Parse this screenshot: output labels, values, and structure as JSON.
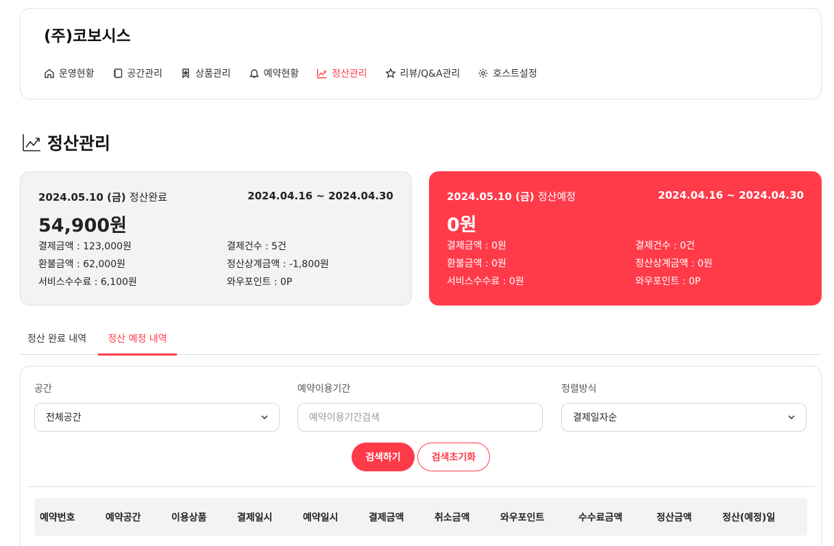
{
  "company": "(주)코보시스",
  "nav": [
    {
      "label": "운영현황",
      "icon": "home-icon"
    },
    {
      "label": "공간관리",
      "icon": "notebook-icon"
    },
    {
      "label": "상품관리",
      "icon": "bookmark-icon"
    },
    {
      "label": "예약현황",
      "icon": "bell-icon"
    },
    {
      "label": "정산관리",
      "icon": "trend-up-icon",
      "active": true
    },
    {
      "label": "리뷰/Q&A관리",
      "icon": "star-icon"
    },
    {
      "label": "호스트설정",
      "icon": "gear-icon"
    }
  ],
  "page_title": "정산관리",
  "accent_color": "#ff3b4a",
  "settle_done": {
    "date": "2024.05.10 (금)",
    "status": "정산완료",
    "range": "2024.04.16 ~ 2024.04.30",
    "amount": "54,900원",
    "payment": "결제금액 : 123,000원",
    "refund": "환불금액 : 62,000원",
    "fee": "서비스수수료 : 6,100원",
    "count": "결제건수 : 5건",
    "offset": "정산상계금액 : -1,800원",
    "point": "와우포인트 : 0P"
  },
  "settle_pending": {
    "date": "2024.05.10 (금)",
    "status": "정산예정",
    "range": "2024.04.16 ~ 2024.04.30",
    "amount": "0원",
    "payment": "결제금액 : 0원",
    "refund": "환불금액 : 0원",
    "fee": "서비스수수료 : 0원",
    "count": "결제건수 : 0건",
    "offset": "정산상계금액 : 0원",
    "point": "와우포인트 : 0P"
  },
  "tabs": [
    "정산 완료 내역",
    "정산 예정 내역"
  ],
  "search": {
    "space_label": "공간",
    "space_value": "전체공간",
    "period_label": "예약이용기간",
    "period_placeholder": "예약이용기간검색",
    "sort_label": "정렬방식",
    "sort_value": "결제일자순",
    "search_button": "검색하기",
    "reset_button": "검색초기화"
  },
  "table_headers": [
    "예약번호",
    "예약공간",
    "이용상품",
    "결제일시",
    "예약일시",
    "결제금액",
    "취소금액",
    "와우포인트",
    "수수료금액",
    "정산금액",
    "정산(예정)일"
  ]
}
